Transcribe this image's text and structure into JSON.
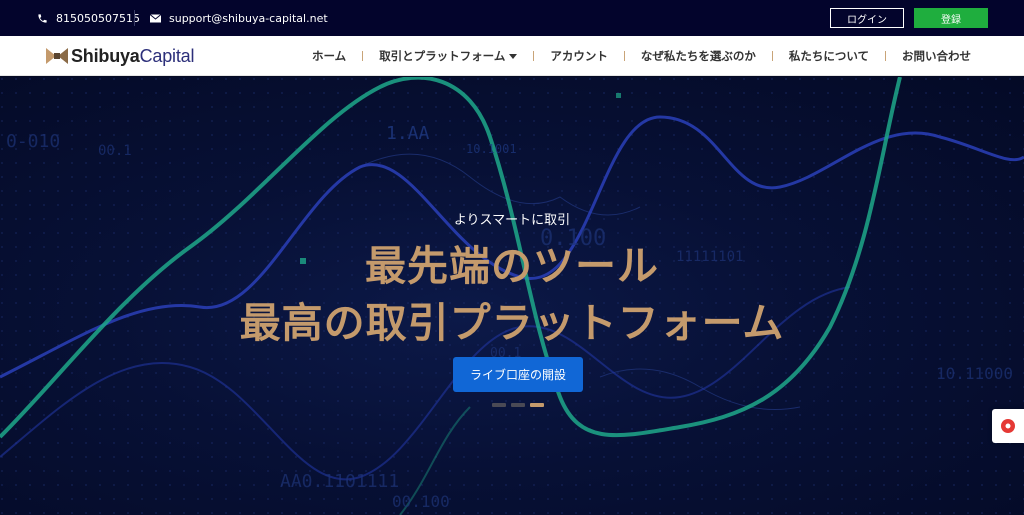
{
  "topbar": {
    "phone": "815050507515",
    "email": "support@shibuya-capital.net",
    "login_label": "ログイン",
    "register_label": "登録"
  },
  "nav": {
    "logo_part1": "Shibuya",
    "logo_part2": "Capital",
    "items": [
      {
        "label": "ホーム"
      },
      {
        "label": "取引とプラットフォーム"
      },
      {
        "label": "アカウント"
      },
      {
        "label": "なぜ私たちを選ぶのか"
      },
      {
        "label": "私たちについて"
      },
      {
        "label": "お問い合わせ"
      }
    ]
  },
  "hero": {
    "subtitle": "よりスマートに取引",
    "title_line1": "最先端のツール",
    "title_line2": "最高の取引プラットフォーム",
    "cta_label": "ライブ口座の開設",
    "bg_numbers": [
      "0-010",
      "00.1",
      "1.AA",
      "10.1001",
      "0.100",
      "11111101",
      "00.1",
      "10.11000",
      "AA0.1101111",
      "00.100"
    ]
  },
  "colors": {
    "topbar_bg": "#03042c",
    "accent_gold": "#c49a6c",
    "cta_blue": "#1167d6",
    "register_green": "#1fae3e",
    "chart_teal": "#1fa889",
    "chart_blue": "#2a3fb8"
  },
  "icons": {
    "phone": "phone-icon",
    "email": "envelope-icon",
    "logo": "bowtie-logo-icon",
    "widget": "record-icon"
  }
}
